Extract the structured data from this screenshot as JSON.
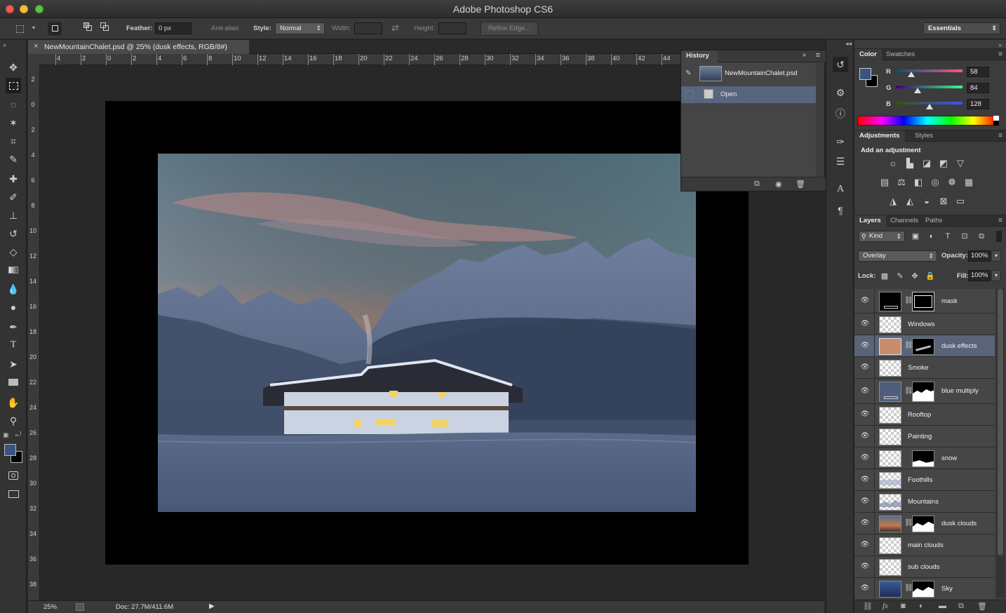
{
  "window": {
    "title": "Adobe Photoshop CS6"
  },
  "options_bar": {
    "feather_label": "Feather:",
    "feather_value": "0 px",
    "antialias_label": "Anti-alias",
    "style_label": "Style:",
    "style_value": "Normal",
    "width_label": "Width:",
    "height_label": "Height:",
    "refine_edge_label": "Refine Edge...",
    "workspace_value": "Essentials"
  },
  "document": {
    "tab_title": "NewMountainChalet.psd @ 25% (dusk effects, RGB/8#)",
    "ruler_top": [
      "4",
      "2",
      "0",
      "2",
      "4",
      "6",
      "8",
      "10",
      "12",
      "14",
      "16",
      "18",
      "20",
      "22",
      "24",
      "26",
      "28",
      "30",
      "32",
      "34",
      "36",
      "38",
      "40",
      "42",
      "44"
    ],
    "ruler_left": [
      "2",
      "0",
      "2",
      "4",
      "6",
      "8",
      "10",
      "12",
      "14",
      "16",
      "18",
      "20",
      "22",
      "24",
      "26",
      "28",
      "30",
      "32",
      "34",
      "36",
      "38"
    ]
  },
  "status": {
    "zoom": "25%",
    "doc_size": "Doc: 27.7M/411.6M"
  },
  "history": {
    "tab": "History",
    "snapshot_label": "NewMountainChalet.psd",
    "items": [
      {
        "label": "Open"
      }
    ]
  },
  "color_panel": {
    "tabs": [
      "Color",
      "Swatches"
    ],
    "r_label": "R",
    "g_label": "G",
    "b_label": "B",
    "r": 58,
    "g": 84,
    "b": 128,
    "foreground": "#3a5480",
    "background": "#000000"
  },
  "adjustments_panel": {
    "tabs": [
      "Adjustments",
      "Styles"
    ],
    "heading": "Add an adjustment"
  },
  "layers_panel": {
    "tabs": [
      "Layers",
      "Channels",
      "Paths"
    ],
    "filter_kind": "Kind",
    "blend_mode": "Overlay",
    "opacity_label": "Opacity:",
    "opacity_value": "100%",
    "lock_label": "Lock:",
    "fill_label": "Fill:",
    "fill_value": "100%",
    "layers": [
      {
        "name": "mask"
      },
      {
        "name": "Windows"
      },
      {
        "name": "dusk effects"
      },
      {
        "name": "Smoke"
      },
      {
        "name": "blue multiply"
      },
      {
        "name": "Rooftop"
      },
      {
        "name": "Painting"
      },
      {
        "name": "snow"
      },
      {
        "name": "Foothills"
      },
      {
        "name": "Mountains"
      },
      {
        "name": "dusk clouds"
      },
      {
        "name": "main clouds"
      },
      {
        "name": "sub clouds"
      },
      {
        "name": "Sky"
      }
    ]
  }
}
